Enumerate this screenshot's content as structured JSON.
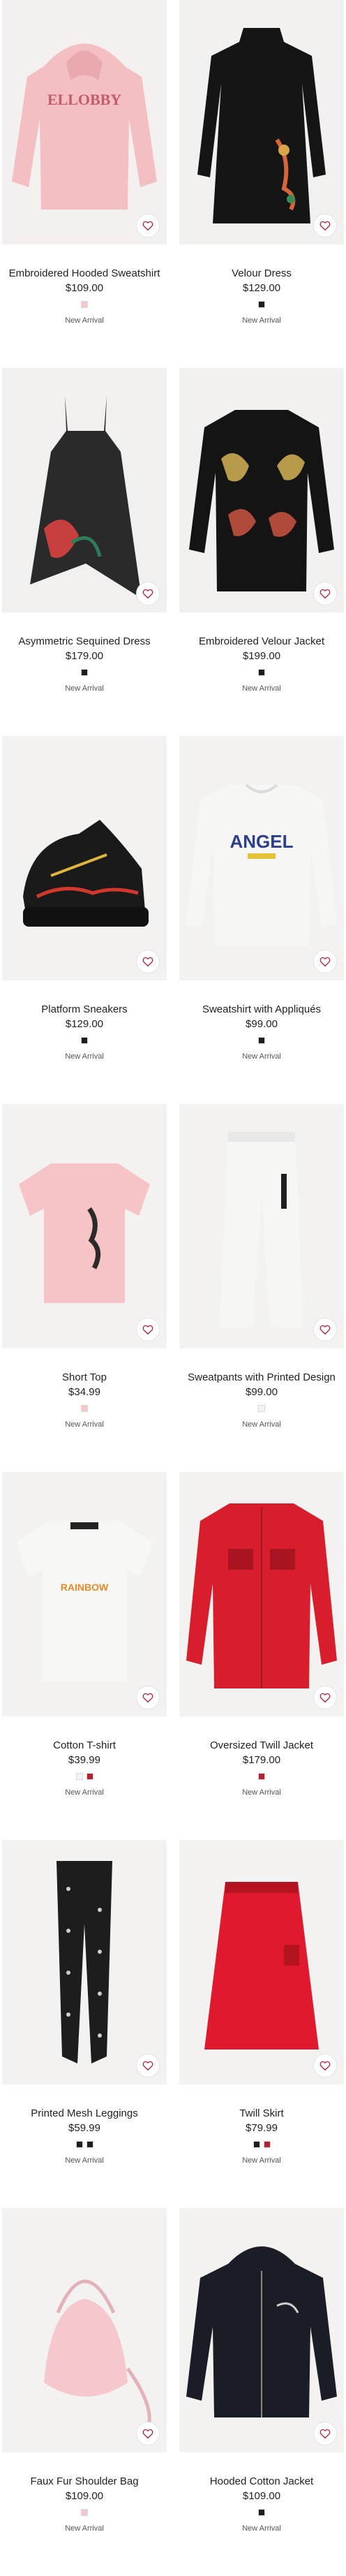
{
  "products": [
    {
      "name": "Embroidered Hooded Sweatshirt",
      "price": "$109.00",
      "swatches": [
        "#f5c6ca"
      ],
      "marker": "New Arrival",
      "image_bg": "#f3f0ef",
      "garment_color": "#f4bfc3",
      "kind": "hoodie",
      "print_text": "ELLOBBY",
      "print_color": "#c45c6a"
    },
    {
      "name": "Velour Dress",
      "price": "$129.00",
      "swatches": [
        "#1e1e1e"
      ],
      "marker": "New Arrival",
      "image_bg": "#f2f1ef",
      "garment_color": "#151515",
      "kind": "dress",
      "print_text": "",
      "print_color": "#d5663a"
    },
    {
      "name": "Asymmetric Sequined Dress",
      "price": "$179.00",
      "swatches": [
        "#1e1e1e"
      ],
      "marker": "New Arrival",
      "image_bg": "#f1f0ee",
      "garment_color": "#2a2a2a",
      "kind": "slipdress",
      "print_text": "",
      "print_color": "#c8403d"
    },
    {
      "name": "Embroidered Velour Jacket",
      "price": "$199.00",
      "swatches": [
        "#1e1e1e"
      ],
      "marker": "New Arrival",
      "image_bg": "#f2f1ef",
      "garment_color": "#141414",
      "kind": "jacket",
      "print_text": "",
      "print_color": "#b79a4a"
    },
    {
      "name": "Platform Sneakers",
      "price": "$129.00",
      "swatches": [
        "#1e1e1e"
      ],
      "marker": "New Arrival",
      "image_bg": "#f3f2f0",
      "garment_color": "#1a1a1a",
      "kind": "sneaker",
      "print_text": "",
      "print_color": "#d2382c"
    },
    {
      "name": "Sweatshirt with Appliqués",
      "price": "$99.00",
      "swatches": [
        "#1e1e1e"
      ],
      "marker": "New Arrival",
      "image_bg": "#f3f2f0",
      "garment_color": "#f6f6f4",
      "kind": "sweatshirt",
      "print_text": "ANGEL",
      "print_color": "#2c3e8c"
    },
    {
      "name": "Short Top",
      "price": "$34.99",
      "swatches": [
        "#f5c6ca"
      ],
      "marker": "New Arrival",
      "image_bg": "#f3f2f0",
      "garment_color": "#f6c3c6",
      "kind": "tee",
      "print_text": "",
      "print_color": "#2a2a2a"
    },
    {
      "name": "Sweatpants with Printed Design",
      "price": "$99.00",
      "swatches": [
        "#f4f4f4"
      ],
      "marker": "New Arrival",
      "image_bg": "#f3f2f0",
      "garment_color": "#f6f6f4",
      "kind": "pants",
      "print_text": "",
      "print_color": "#1f1f1f"
    },
    {
      "name": "Cotton T-shirt",
      "price": "$39.99",
      "swatches": [
        "#f4f4f4",
        "#b3202f"
      ],
      "marker": "New Arrival",
      "image_bg": "#f3f2f0",
      "garment_color": "#f7f7f5",
      "kind": "tee2",
      "print_text": "RAINBOW",
      "print_color": "#e8892a"
    },
    {
      "name": "Oversized Twill Jacket",
      "price": "$179.00",
      "swatches": [
        "#b3202f"
      ],
      "marker": "New Arrival",
      "image_bg": "#f3f2f0",
      "garment_color": "#d81e2c",
      "kind": "shacket",
      "print_text": "",
      "print_color": "#a8141f"
    },
    {
      "name": "Printed Mesh Leggings",
      "price": "$59.99",
      "swatches": [
        "#1e1e1e",
        "#1e1e1e"
      ],
      "marker": "New Arrival",
      "image_bg": "#f3f2f0",
      "garment_color": "#1d1d1d",
      "kind": "leggings",
      "print_text": "",
      "print_color": "#cfcfcf"
    },
    {
      "name": "Twill Skirt",
      "price": "$79.99",
      "swatches": [
        "#1e1e1e",
        "#b3202f"
      ],
      "marker": "New Arrival",
      "image_bg": "#f3f2f0",
      "garment_color": "#e0192e",
      "kind": "skirt",
      "print_text": "",
      "print_color": "#b3141f"
    },
    {
      "name": "Faux Fur Shoulder Bag",
      "price": "$109.00",
      "swatches": [
        "#f5c6ca"
      ],
      "marker": "New Arrival",
      "image_bg": "#f3f2f0",
      "garment_color": "#f6c7cc",
      "kind": "bag",
      "print_text": "",
      "print_color": "#e9a7b0"
    },
    {
      "name": "Hooded Cotton Jacket",
      "price": "$109.00",
      "swatches": [
        "#1e1e1e"
      ],
      "marker": "New Arrival",
      "image_bg": "#f3f2f0",
      "garment_color": "#1b1d26",
      "kind": "zip",
      "print_text": "",
      "print_color": "#cfcfcf"
    }
  ],
  "icons": {
    "favorite": "heart-outline-icon"
  },
  "accent_color": "#c8102e"
}
